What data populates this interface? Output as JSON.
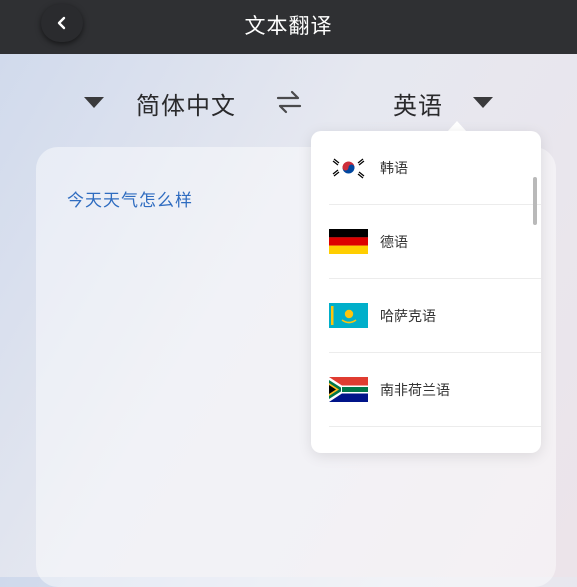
{
  "header": {
    "title": "文本翻译",
    "back_icon": "chevron-left-icon"
  },
  "languages": {
    "source": "简体中文",
    "target": "英语",
    "swap_icon": "swap-arrows-icon"
  },
  "input": {
    "text": "今天天气怎么样"
  },
  "dropdown": {
    "items": [
      {
        "label": "韩语",
        "flag": "south-korea-flag-icon"
      },
      {
        "label": "德语",
        "flag": "germany-flag-icon"
      },
      {
        "label": "哈萨克语",
        "flag": "kazakhstan-flag-icon"
      },
      {
        "label": "南非荷兰语",
        "flag": "south-africa-flag-icon"
      }
    ]
  },
  "colors": {
    "header_bg": "#2f3033",
    "input_text": "#2f6cc0"
  }
}
